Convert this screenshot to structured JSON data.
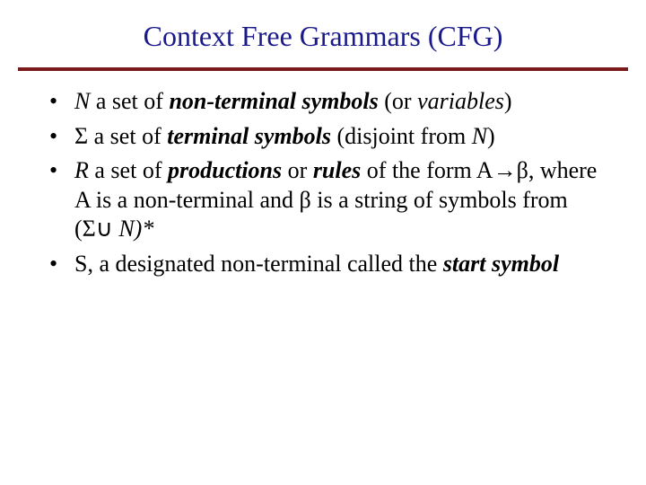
{
  "title": "Context Free Grammars (CFG)",
  "bullets": {
    "b1": {
      "N": "N",
      "t1": " a set of ",
      "nts": "non-terminal symbols",
      "t2": " (or ",
      "vars": "variables",
      "t3": ")"
    },
    "b2": {
      "sigma": "Σ",
      "t1": " a set of ",
      "ts": "terminal symbols",
      "t2": " (disjoint from ",
      "N": "N",
      "t3": ")"
    },
    "b3": {
      "R": "R",
      "t1": " a set of ",
      "prods": "productions",
      "t2": " or ",
      "rules": "rules",
      "t3": " of the form A→β, where A is a non-terminal and β is a string of symbols from (Σ",
      "cup": "∪",
      "t4": " ",
      "N": "N)*"
    },
    "b4": {
      "t1": "S, a designated non-terminal called the ",
      "ss": "start symbol"
    }
  }
}
